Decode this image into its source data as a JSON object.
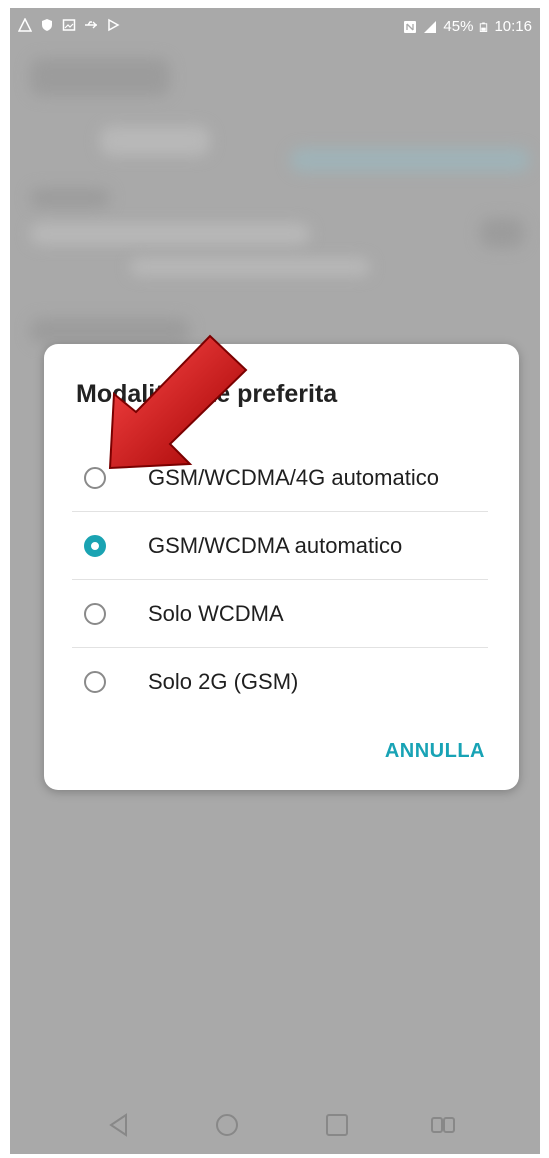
{
  "status_bar": {
    "left_icons": [
      "warning-icon",
      "shield-icon",
      "image-icon",
      "usb-icon",
      "play-icon"
    ],
    "nfc_icon": "nfc-icon",
    "signal_icon": "signal-icon",
    "battery_percent": "45%",
    "battery_icon": "battery-icon",
    "time": "10:16"
  },
  "dialog": {
    "title": "Modalità rete preferita",
    "options": [
      {
        "label": "GSM/WCDMA/4G automatico",
        "selected": false
      },
      {
        "label": "GSM/WCDMA automatico",
        "selected": true
      },
      {
        "label": "Solo WCDMA",
        "selected": false
      },
      {
        "label": "Solo 2G (GSM)",
        "selected": false
      }
    ],
    "cancel_label": "ANNULLA"
  },
  "nav_bar": {
    "icons": [
      "back-icon",
      "home-icon",
      "recents-icon",
      "dual-window-icon"
    ]
  },
  "colors": {
    "accent": "#1aa3b2",
    "overlay": "#a9a9a9",
    "arrow": "#cc1111"
  }
}
